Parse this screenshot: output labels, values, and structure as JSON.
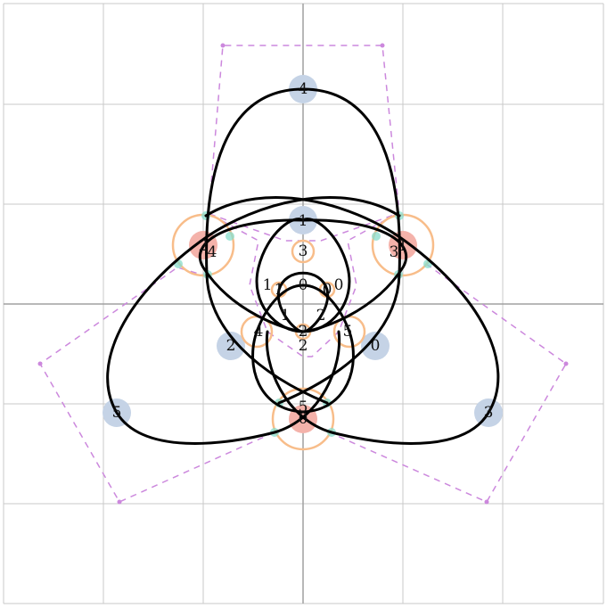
{
  "colors": {
    "background": "#ffffff",
    "grid": "#c8c8c8",
    "axis": "#a0a0a0",
    "curve": "#000000",
    "control_polygon": "#cc88dd",
    "vertex_disc": "#c5d3e6",
    "crossing_disc": "#f4b2aa",
    "crossing_ring": "#f8bd8a",
    "tangent_marker": "#88ddcc"
  },
  "labels": {
    "outer_lobe_top": "4",
    "outer_lobe_left": "5",
    "outer_lobe_right": "3",
    "inner_top": "1",
    "inner_left": "2",
    "inner_right": "0",
    "bottom_cusp": "5",
    "bottom_cusp_index": "0",
    "left_cusp": "2",
    "left_cusp_index": "4",
    "right_cusp": "3",
    "right_cusp_index": "1",
    "center_top": "3",
    "center_mid_left": "1",
    "center_mid_top": "0",
    "center_mid_right": "0",
    "center_inner_left": "1",
    "center_inner_right": "2",
    "center_bottom": "2",
    "ring_left": "4",
    "ring_right": "5",
    "small_top": "0",
    "small_left": "1",
    "small_bottom": "2"
  }
}
